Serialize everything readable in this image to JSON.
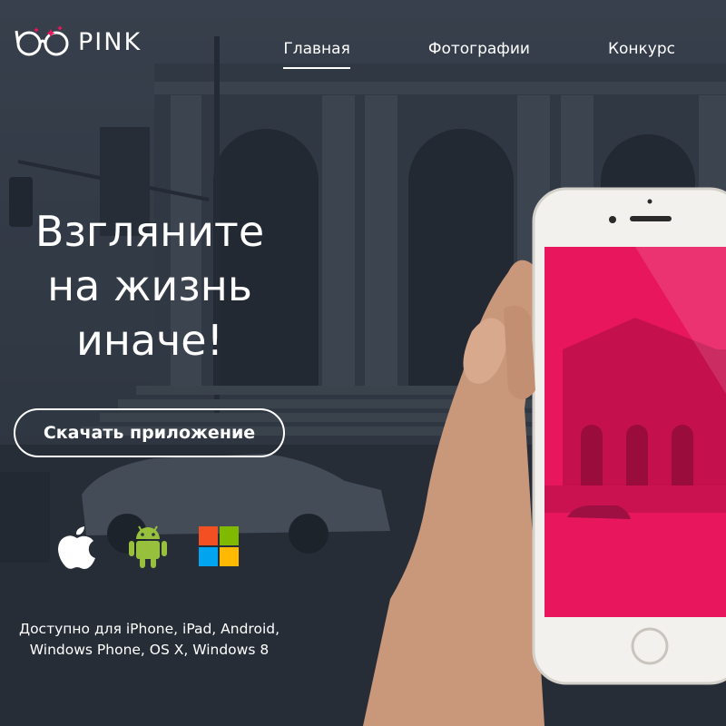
{
  "brand": {
    "name": "PINK",
    "logo_icon": "glasses-icon"
  },
  "nav": {
    "items": [
      {
        "label": "Главная",
        "active": true
      },
      {
        "label": "Фотографии",
        "active": false
      },
      {
        "label": "Конкурс",
        "active": false
      }
    ]
  },
  "hero": {
    "headline_lines": [
      "Взгляните",
      "на жизнь",
      "иначе!"
    ],
    "cta_label": "Скачать приложение",
    "platforms": [
      "apple-icon",
      "android-icon",
      "windows-icon"
    ],
    "availability_lines": [
      "Доступно для iPhone, iPad, Android,",
      "Windows Phone, OS X, Windows 8"
    ]
  },
  "colors": {
    "accent_pink": "#e8175d",
    "text": "#ffffff",
    "android_green": "#97c03d",
    "ms_red": "#f25022",
    "ms_green": "#7fba00",
    "ms_blue": "#00a4ef",
    "ms_yellow": "#ffb900"
  }
}
